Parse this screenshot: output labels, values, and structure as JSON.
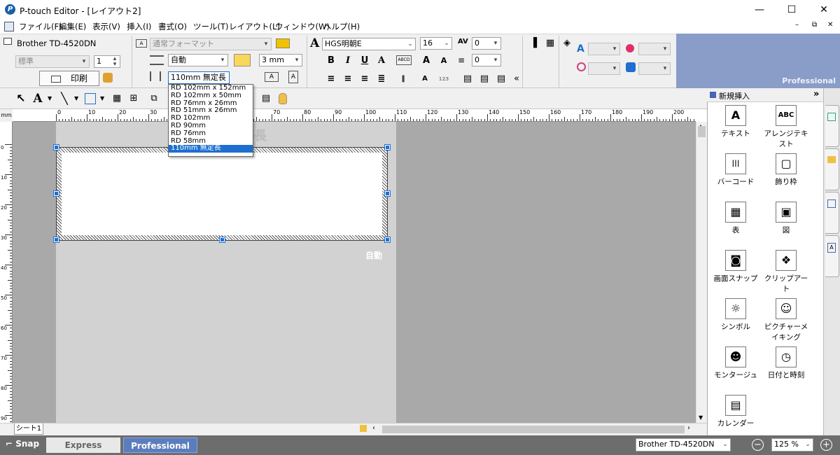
{
  "window": {
    "title": "P-touch Editor - [レイアウト2]",
    "minimize": "—",
    "maximize": "☐",
    "close": "✕",
    "mdi_min": "–",
    "mdi_restore": "⧉",
    "mdi_close": "✕"
  },
  "menu": [
    "ファイル(F)",
    "編集(E)",
    "表示(V)",
    "挿入(I)",
    "書式(O)",
    "ツール(T)",
    "レイアウト(L)",
    "ウィンドウ(W)",
    "ヘルプ(H)"
  ],
  "ribbon": {
    "printer_name": "Brother TD-4520DN",
    "quality": "標準",
    "copies": "1",
    "print_label": "印刷",
    "format": "通常フォーマット",
    "length_mode": "自動",
    "margin": "3 mm",
    "media": "110mm 無定長",
    "font_name": "HGS明朝E",
    "font_size": "16",
    "char_spacing": "0",
    "line_spacing": "0",
    "bold": "B",
    "italic": "I",
    "underline": "U",
    "collapse": "«",
    "edition": "Professional"
  },
  "media_options": [
    "RD 102mm x 152mm",
    "RD 102mm x 50mm",
    "RD 76mm x 26mm",
    "RD 51mm x 26mm",
    "RD 102mm",
    "RD 90mm",
    "RD 76mm",
    "RD 58mm",
    "110mm 無定長"
  ],
  "media_selected_index": 8,
  "canvas": {
    "length_hint": "長",
    "auto_label": "自動",
    "sheet_tab": "シート1"
  },
  "hruler_labels": [
    "0",
    "10",
    "20",
    "30",
    "40",
    "50",
    "60",
    "70",
    "80",
    "90",
    "100",
    "110",
    "120",
    "130",
    "140",
    "150",
    "160",
    "170",
    "180",
    "190",
    "200"
  ],
  "vruler_labels": [
    "0",
    "10",
    "20",
    "30",
    "40",
    "50",
    "60",
    "70",
    "80",
    "90"
  ],
  "ruler_unit": "mm",
  "insert_panel": {
    "header": "新規挿入",
    "expand": "»",
    "items": [
      {
        "label": "テキスト",
        "icon": "text-icon",
        "glyph": "A"
      },
      {
        "label": "アレンジテキスト",
        "icon": "arranged-text-icon",
        "glyph": "ABC"
      },
      {
        "label": "バーコード",
        "icon": "barcode-icon",
        "glyph": "|||"
      },
      {
        "label": "飾り枠",
        "icon": "frame-icon",
        "glyph": "▢"
      },
      {
        "label": "表",
        "icon": "table-icon",
        "glyph": "▦"
      },
      {
        "label": "図",
        "icon": "image-icon",
        "glyph": "▣"
      },
      {
        "label": "画面スナップ",
        "icon": "screen-snap-icon",
        "glyph": "◙"
      },
      {
        "label": "クリップアート",
        "icon": "clipart-icon",
        "glyph": "❖"
      },
      {
        "label": "シンボル",
        "icon": "symbol-icon",
        "glyph": "☼"
      },
      {
        "label": "ピクチャーメイキング",
        "icon": "picture-making-icon",
        "glyph": "☺"
      },
      {
        "label": "モンタージュ",
        "icon": "montage-icon",
        "glyph": "☻"
      },
      {
        "label": "日付と時刻",
        "icon": "clock-icon",
        "glyph": "◷"
      },
      {
        "label": "カレンダー",
        "icon": "calendar-icon",
        "glyph": "▤"
      }
    ]
  },
  "status": {
    "snap": "Snap",
    "express": "Express",
    "professional": "Professional",
    "printer": "Brother TD-4520DN",
    "zoom": "125 %",
    "zoom_out": "−",
    "zoom_in": "+"
  },
  "colors": {
    "accent": "#1e6fd0",
    "pro_header": "#8a9cc8",
    "status_bar": "#6d6d6d",
    "pro_button": "#5b7dbd"
  }
}
